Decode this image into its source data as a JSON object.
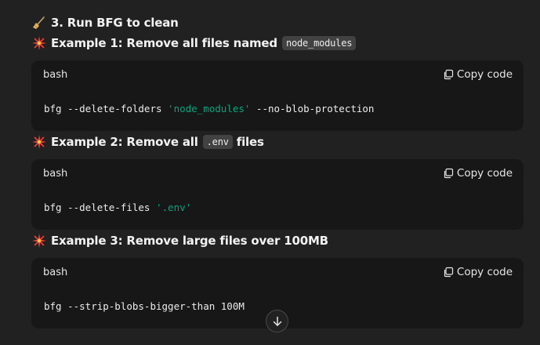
{
  "section_heading": "3. Run BFG to clean",
  "icons": {
    "section": "broom-icon",
    "example": "sparkle-icon",
    "copy": "copy-icon",
    "scroll": "arrow-down-icon"
  },
  "colors": {
    "background": "#212121",
    "code_background": "#171717",
    "string": "#00a67d"
  },
  "examples": [
    {
      "heading": "Example 1: Remove all files named",
      "inline_code": "node_modules",
      "heading_suffix": "",
      "lang": "bash",
      "copy_label": "Copy code",
      "code_prefix": "bfg --delete-folders ",
      "code_string": "'node_modules'",
      "code_suffix": " --no-blob-protection"
    },
    {
      "heading": "Example 2: Remove all",
      "inline_code": ".env",
      "heading_suffix": "files",
      "lang": "bash",
      "copy_label": "Copy code",
      "code_prefix": "bfg --delete-files ",
      "code_string": "'.env'",
      "code_suffix": ""
    },
    {
      "heading": "Example 3: Remove large files over 100MB",
      "inline_code": "",
      "heading_suffix": "",
      "lang": "bash",
      "copy_label": "Copy code",
      "code_prefix": "bfg --strip-blobs-bigger-than 100M",
      "code_string": "",
      "code_suffix": ""
    }
  ]
}
